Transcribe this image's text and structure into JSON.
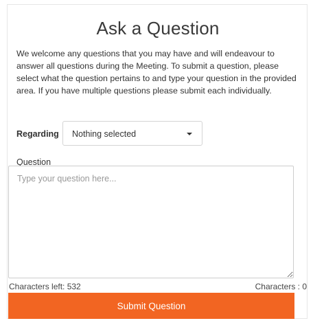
{
  "form": {
    "title": "Ask a Question",
    "intro": "We welcome any questions that you may have and will endeavour to answer all questions during the Meeting. To submit a question, please select what the question pertains to and type your question in the provided area. If you have multiple questions please submit each individually.",
    "regarding": {
      "label": "Regarding",
      "selected": "Nothing selected",
      "icon": "caret-down-icon"
    },
    "question": {
      "label": "Question",
      "value": "",
      "placeholder": "Type your question here..."
    },
    "characters_left_label": "Characters left: 532",
    "characters_count_label": "Characters : 0",
    "submit_label": "Submit Question"
  },
  "colors": {
    "accent": "#f26522",
    "border": "#cccccc",
    "text": "#333333"
  }
}
